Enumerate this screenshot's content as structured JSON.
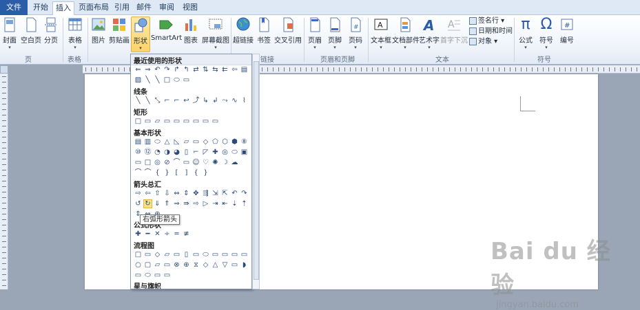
{
  "tabs": [
    {
      "label": "文件"
    },
    {
      "label": "开始"
    },
    {
      "label": "插入"
    },
    {
      "label": "页面布局"
    },
    {
      "label": "引用"
    },
    {
      "label": "邮件"
    },
    {
      "label": "审阅"
    },
    {
      "label": "视图"
    }
  ],
  "ribbon": {
    "buttons": {
      "cover": "封面",
      "blank": "空白页",
      "pagebreak": "分页",
      "table": "表格",
      "picture": "图片",
      "clipart": "剪贴画",
      "shapes": "形状",
      "smartart": "SmartArt",
      "chart": "图表",
      "screenshot": "屏幕截图",
      "hyperlink": "超链接",
      "bookmark": "书签",
      "crossref": "交叉引用",
      "header": "页眉",
      "footer": "页脚",
      "pagenum": "页码",
      "textbox": "文本框",
      "quickparts": "文档部件",
      "wordart": "艺术字",
      "dropcap": "首字下沉",
      "equation": "公式",
      "symbol": "符号",
      "number": "编号"
    },
    "small": {
      "signature": "签名行",
      "datetime": "日期和时间",
      "object": "对象"
    },
    "groups": {
      "pages": "页",
      "tables": "表格",
      "links": "链接",
      "headerfooter": "页眉和页脚",
      "text": "文本",
      "symbols": "符号"
    }
  },
  "shapes_panel": {
    "categories": {
      "recent": "最近使用的形状",
      "lines": "线条",
      "rect": "矩形",
      "basic": "基本形状",
      "arrows": "箭头总汇",
      "equation": "公式形状",
      "flow": "流程图",
      "stars": "星与旗帜"
    },
    "tooltip": "右弧形箭头"
  },
  "watermark": {
    "brand": "Bai du 经验",
    "url": "jingyan.baidu.com"
  }
}
